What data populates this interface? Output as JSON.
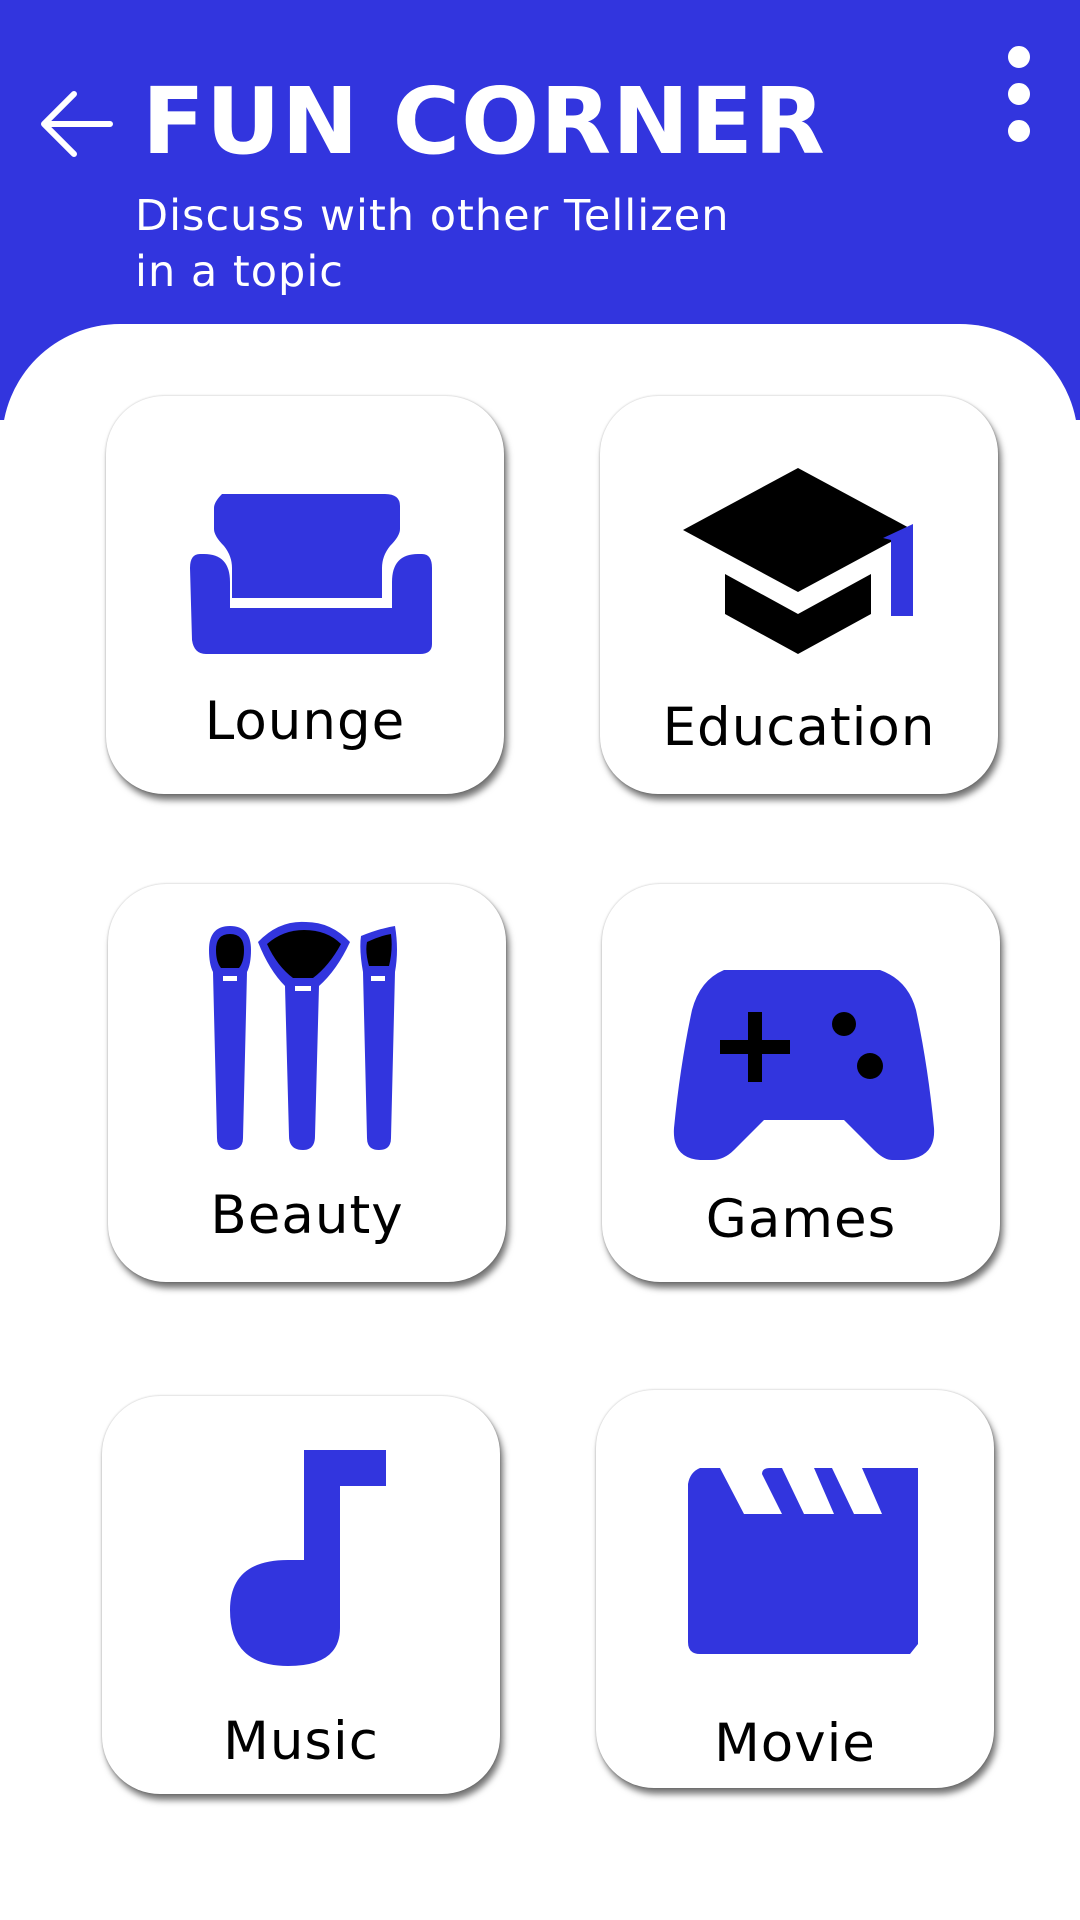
{
  "header": {
    "title": "FUN CORNER",
    "subtitle": "Discuss with other Tellizen in a topic",
    "back_icon": "arrow-left-icon",
    "menu_icon": "more-vertical-icon"
  },
  "categories": [
    {
      "label": "Lounge",
      "icon": "sofa-icon"
    },
    {
      "label": "Education",
      "icon": "graduation-cap-icon"
    },
    {
      "label": "Beauty",
      "icon": "makeup-brushes-icon"
    },
    {
      "label": "Games",
      "icon": "gamepad-icon"
    },
    {
      "label": "Music",
      "icon": "music-note-icon"
    },
    {
      "label": "Movie",
      "icon": "clapperboard-icon"
    }
  ],
  "colors": {
    "primary": "#3235de",
    "background": "#ffffff",
    "text": "#000000"
  }
}
